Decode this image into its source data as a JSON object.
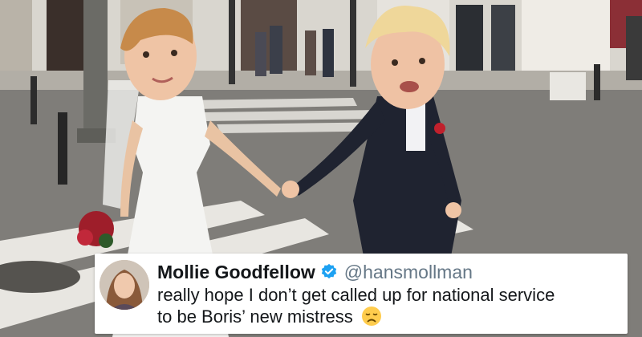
{
  "tweet": {
    "display_name": "Mollie Goodfellow",
    "handle": "@hansmollman",
    "text_line1": "really hope I don’t get called up for national service",
    "text_line2": "to be Boris’ new mistress",
    "verified": true,
    "emoji": "disappointed-face-icon",
    "colors": {
      "name": "#14171a",
      "handle": "#657786",
      "verified": "#1da1f2",
      "emoji": "#ffcc4d"
    }
  },
  "scene": {
    "subjects": "bride-and-groom-crossing-street"
  }
}
